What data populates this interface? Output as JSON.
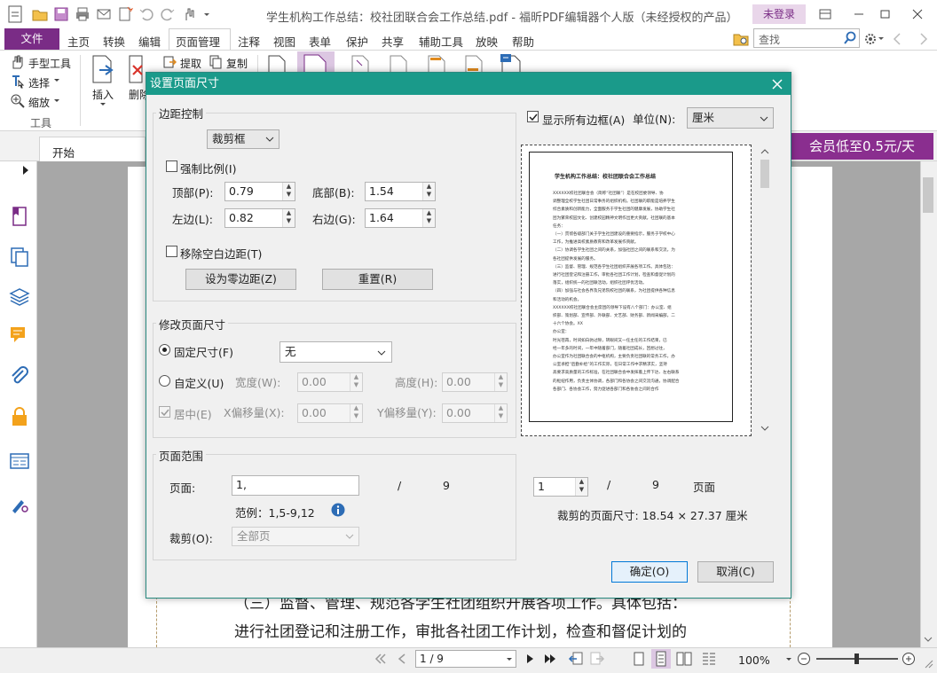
{
  "app": {
    "title": "学生机构工作总结：校社团联合会工作总结.pdf - 福昕PDF编辑器个人版（未经授权的产品）",
    "login": "未登录"
  },
  "menu": {
    "file": "文件",
    "items": [
      "主页",
      "转换",
      "编辑",
      "页面管理",
      "注释",
      "视图",
      "表单",
      "保护",
      "共享",
      "辅助工具",
      "放映",
      "帮助"
    ],
    "search_placeholder": "查找"
  },
  "ribbon": {
    "hand_tool": "手型工具",
    "select": "选择",
    "zoom": "缩放",
    "tools_group": "工具",
    "insert": "插入",
    "delete": "删除",
    "extract": "提取",
    "copy": "复制"
  },
  "tabs": {
    "start": "开始",
    "promo": "会员低至0.5元/天"
  },
  "document": {
    "line1": "（三）监督、管理、规范各学生社团组织开展各项工作。具体包括：",
    "line2": "进行社团登记和注册工作，审批各社团工作计划，检查和督促计划的"
  },
  "status": {
    "page": "1 / 9",
    "zoom": "100%"
  },
  "dialog": {
    "title": "设置页面尺寸",
    "margins": {
      "legend": "边距控制",
      "box_select": "裁剪框",
      "force_ratio": "强制比例(I)",
      "top_label": "顶部(P):",
      "top": "0.79",
      "bottom_label": "底部(B):",
      "bottom": "1.54",
      "left_label": "左边(L):",
      "left": "0.82",
      "right_label": "右边(G):",
      "right": "1.64",
      "remove_white": "移除空白边距(T)",
      "zero_btn": "设为零边距(Z)",
      "reset_btn": "重置(R)"
    },
    "pagesize": {
      "legend": "修改页面尺寸",
      "fixed": "固定尺寸(F)",
      "fixed_value": "无",
      "custom": "自定义(U)",
      "width_label": "宽度(W):",
      "width": "0.00",
      "height_label": "高度(H):",
      "height": "0.00",
      "center": "居中(E)",
      "xoff_label": "X偏移量(X):",
      "xoff": "0.00",
      "yoff_label": "Y偏移量(Y):",
      "yoff": "0.00"
    },
    "range": {
      "legend": "页面范围",
      "pages_label": "页面:",
      "pages_value": "1,",
      "slash": "/",
      "total": "9",
      "example": "范例：1,5-9,12",
      "crop_label": "裁剪(O):",
      "crop_value": "全部页"
    },
    "preview": {
      "show_all": "显示所有边框(A)",
      "unit_label": "单位(N):",
      "unit_value": "厘米",
      "page_num": "1",
      "slash": "/",
      "total": "9",
      "page_word": "页面",
      "crop_size": "裁剪的页面尺寸: 18.54 × 27.37 厘米",
      "thumb_title": "学生机构工作总结：校社团联合会工作总结",
      "thumb_lines": [
        "XXXXXX校社团联合会（简称“社团联”）是在校团委领导、协",
        "调整理全校学生社团日常事务的组织机构。社团联的职能是培养学生",
        "综合素质和创新能力，全面服务于学生社团的健康发展，协助学生社",
        "团为繁荣校园文化、创建校园精神文明作出更大贡献。社团联的基本",
        "任务：",
        "（一）贯彻各级部门关于学生社团建设的重要指示，服务于学校中心",
        "工作，为推进高校素质教育和改革发展作贡献。",
        "（二）协调各学生社团之间的关系，加强社团之间的联系和交流，为",
        "各社团提供发展的服务。",
        "（三）监督、管理、规范各学生社团组织开展各项工作。具体包括：",
        "进行社团登记和注册工作，审批各社团工作计划，检查和督促计划的",
        "落实，组织统一的社团联活动，组织社团评优活动。",
        "（四）加强与社会各界及兄弟院校社团的联系，为社团提供各种信息",
        "和活动的机会。",
        "XXXXXX校社团联合会主席团的领导下设有八个部门：办公室、组",
        "织部、策划部、宣传部、外联部、文艺部、财务部、新闻采编部，二",
        "十六个协会。XX",
        "办公室：",
        "时光荏苒，时间如白驹过隙，转眼间又一任主任的工作结束，已",
        "经一年多的时间，一年中随着部门，随着社团成长，回想过往，",
        "办公室作为社团联合会的中枢机构，主要负责社团联的常务工作，办",
        "公室承担“后勤补给”的工作实际，在日常工作中求精求实，坚持",
        "高要求高质量的工作标准，在社团联合会中发挥着上传下达、左右联系",
        "的枢纽作用，负责主体协调，各部门和各协会之间交流沟通，协调配合",
        "各部门、各协会工作，努力促进各部门和各协会之间的合作"
      ]
    },
    "ok": "确定(O)",
    "cancel": "取消(C)"
  }
}
